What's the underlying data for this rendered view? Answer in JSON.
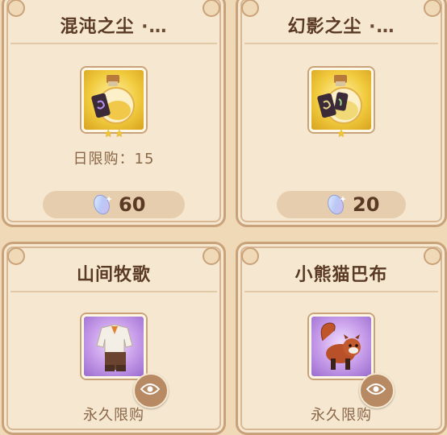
{
  "shop_items": [
    {
      "title": "混沌之尘",
      "more": "·…",
      "icon": "chaos-dust-bottle-icon",
      "stars": 2,
      "limit_label": "日限购：15",
      "price": "60",
      "currency_icon": "crystal-gem-icon"
    },
    {
      "title": "幻影之尘",
      "more": "·…",
      "icon": "phantom-dust-bottle-icon",
      "stars": 1,
      "price": "20",
      "currency_icon": "crystal-gem-icon"
    },
    {
      "title": "山间牧歌",
      "icon": "outfit-icon",
      "limit_label": "永久限购",
      "preview_icon": "eye-icon"
    },
    {
      "title": "小熊猫巴布",
      "icon": "red-panda-icon",
      "limit_label": "永久限购",
      "preview_icon": "eye-icon"
    }
  ],
  "colors": {
    "card_bg": "#f6e8d0",
    "border": "#c9a27a",
    "title_text": "#5a3a24",
    "gold_frame": "#f1cb3e",
    "purple_frame": "#c59ae8"
  }
}
